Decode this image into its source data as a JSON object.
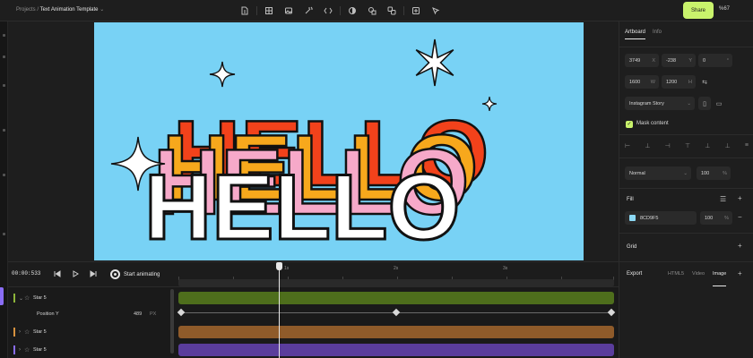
{
  "header": {
    "breadcrumb_root": "Projects",
    "breadcrumb_sep": "/",
    "project_name": "Text Animation Template",
    "project_caret": "⌄",
    "share_label": "Share",
    "zoom_level": "%67"
  },
  "canvas": {
    "headline": "HELLO",
    "background_color": "#78D2F5",
    "layer_colors": [
      "#F2421B",
      "#F7A81C",
      "#F6A9C9",
      "#FFFFFF"
    ]
  },
  "transport": {
    "timecode": "00:00:533",
    "start_animating_label": "Start animating",
    "ruler_labels": [
      "1s",
      "2s",
      "3s"
    ]
  },
  "timeline": {
    "layers": [
      {
        "name": "Star 5",
        "color": "#4E6E1C",
        "expanded": true
      },
      {
        "name": "Star 5",
        "color": "#8F5B2A",
        "expanded": false
      },
      {
        "name": "Star 5",
        "color": "#5A3D9C",
        "expanded": false
      }
    ],
    "property": {
      "name": "Position Y",
      "value": "489",
      "unit": "PX"
    },
    "keyframes": [
      0,
      0.5,
      1
    ]
  },
  "panel": {
    "tabs": [
      "Artboard",
      "Info"
    ],
    "x": {
      "value": "3749",
      "unit": "X"
    },
    "y": {
      "value": "-238",
      "unit": "Y"
    },
    "rotation": {
      "value": "0",
      "unit": "°"
    },
    "width": {
      "value": "1600",
      "unit": "W"
    },
    "height": {
      "value": "1200",
      "unit": "H"
    },
    "preset": "Instagram Story",
    "preset_caret": "⌄",
    "mask_label": "Mask content",
    "blend_mode": "Normal",
    "blend_caret": "⌄",
    "opacity": {
      "value": "100",
      "unit": "%"
    },
    "fill_label": "Fill",
    "fill_hex": "8CD9F5",
    "fill_color": "#8CD9F5",
    "fill_opacity": {
      "value": "100",
      "unit": "%"
    },
    "grid_label": "Grid",
    "export_label": "Export",
    "export_tabs": [
      "HTML5",
      "Video",
      "Image"
    ]
  }
}
